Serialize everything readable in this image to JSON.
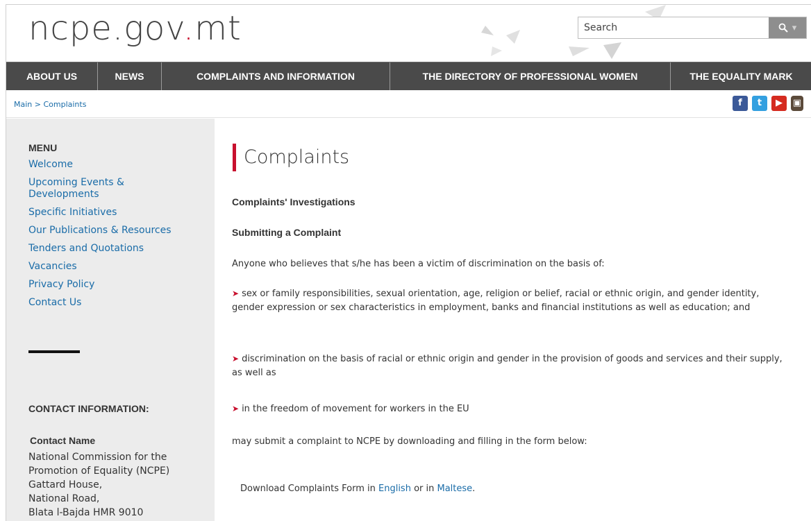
{
  "header": {
    "logo_main": "ncpe.gov",
    "logo_dot": ".",
    "logo_tld": "mt",
    "search_placeholder": "Search",
    "search_icon": "magnifier-icon",
    "dropdown_icon": "caret-down-icon"
  },
  "nav": {
    "items": [
      "ABOUT US",
      "NEWS",
      "COMPLAINTS AND INFORMATION",
      "THE DIRECTORY OF PROFESSIONAL WOMEN",
      "THE EQUALITY MARK"
    ]
  },
  "breadcrumb": "Main > Complaints",
  "social": {
    "facebook": "f",
    "twitter": "t",
    "youtube": "▶",
    "instagram": "▣"
  },
  "sidebar": {
    "menu_title": "MENU",
    "menu_items": [
      "Welcome",
      "Upcoming Events & Developments",
      "Specific Initiatives",
      "Our Publications & Resources",
      "Tenders and Quotations",
      "Vacancies",
      "Privacy Policy",
      "Contact Us"
    ],
    "contact_title": "CONTACT INFORMATION:",
    "contact_name_label": "Contact Name",
    "contact_lines": [
      "National Commission for the",
      "Promotion of Equality (NCPE)",
      "Gattard House,",
      "National Road,",
      "Blata l-Bajda HMR 9010"
    ]
  },
  "content": {
    "title": "Complaints",
    "heading1": "Complaints' Investigations",
    "heading2": "Submitting a Complaint",
    "intro": "Anyone who believes that s/he has been a victim of discrimination on the basis of:",
    "bullets": [
      "sex or family responsibilities, sexual orientation, age, religion or belief, racial or ethnic origin, and gender identity, gender expression or sex characteristics in employment, banks and financial institutions as well as education; and",
      "discrimination on the basis of racial or ethnic origin and gender in the provision of goods and services and their supply, as well as",
      "in the freedom of movement for workers in the EU"
    ],
    "outro": "may submit a complaint to NCPE by downloading and filling in the form below:",
    "download_prefix": "Download Complaints Form in ",
    "download_english": "English",
    "download_mid": " or in ",
    "download_maltese": "Maltese",
    "download_suffix": "."
  },
  "colors": {
    "accent_red": "#c8102e",
    "link_blue": "#1a6ca8",
    "nav_bg": "#4a4a4a",
    "sidebar_bg": "#ececec"
  }
}
